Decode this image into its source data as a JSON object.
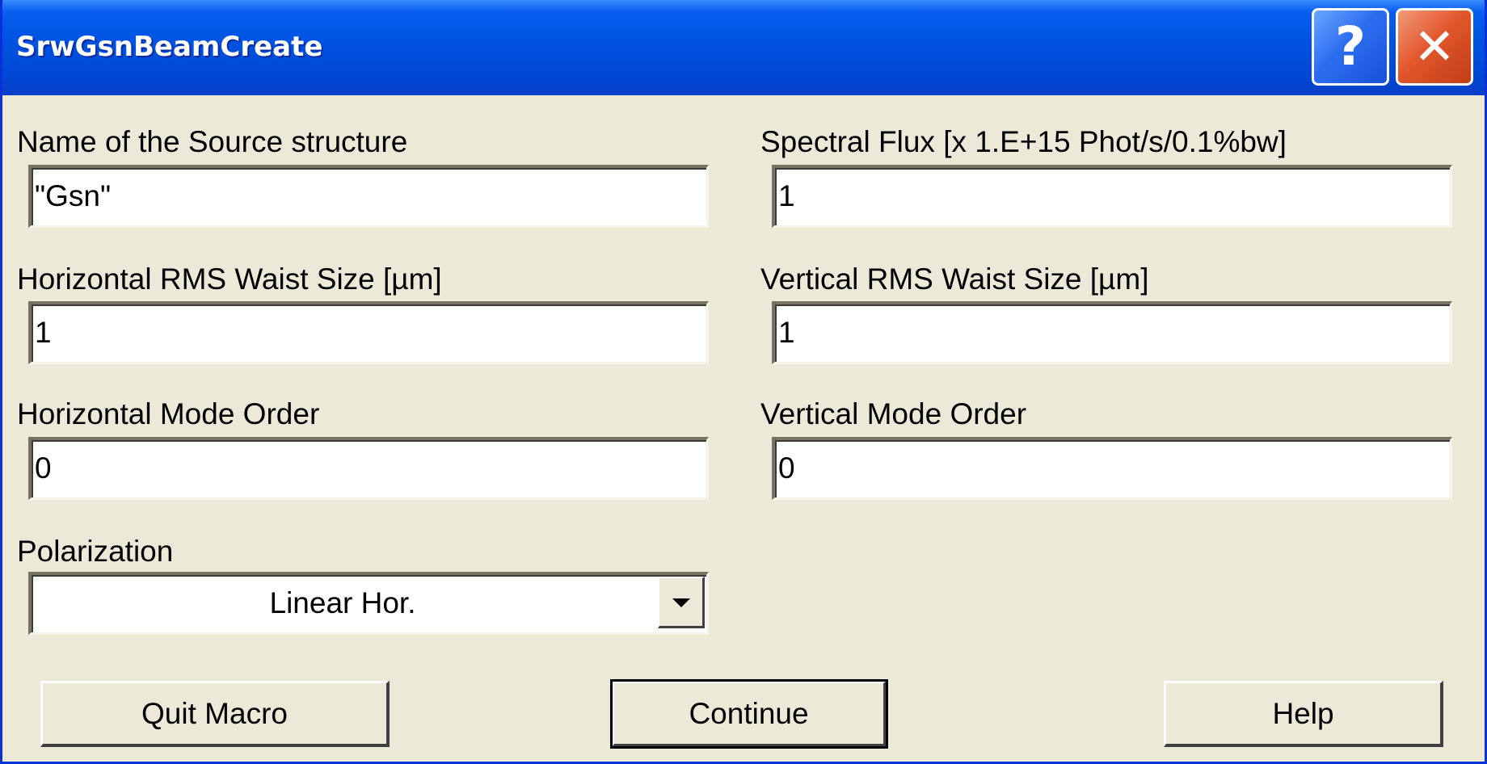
{
  "window": {
    "title": "SrwGsnBeamCreate",
    "help_glyph": "?",
    "close_glyph": "✕"
  },
  "fields": {
    "source_name": {
      "label": "Name of the Source structure",
      "value": "\"Gsn\""
    },
    "spectral_flux": {
      "label": "Spectral Flux [x 1.E+15 Phot/s/0.1%bw]",
      "value": "1"
    },
    "h_waist": {
      "label": "Horizontal RMS Waist Size [µm]",
      "value": "1"
    },
    "v_waist": {
      "label": "Vertical RMS Waist Size [µm]",
      "value": "1"
    },
    "h_mode": {
      "label": "Horizontal Mode Order",
      "value": "0"
    },
    "v_mode": {
      "label": "Vertical Mode Order",
      "value": "0"
    },
    "polarization": {
      "label": "Polarization",
      "value": "Linear Hor."
    }
  },
  "buttons": {
    "quit": "Quit Macro",
    "continue": "Continue",
    "help": "Help"
  },
  "colors": {
    "titlebar": "#0054e3",
    "window_bg": "#ece9d8",
    "close_button": "#e2582e",
    "help_button": "#2c6df0"
  },
  "icons": {
    "help": "help-icon",
    "close": "close-icon",
    "dropdown": "chevron-down-icon"
  }
}
